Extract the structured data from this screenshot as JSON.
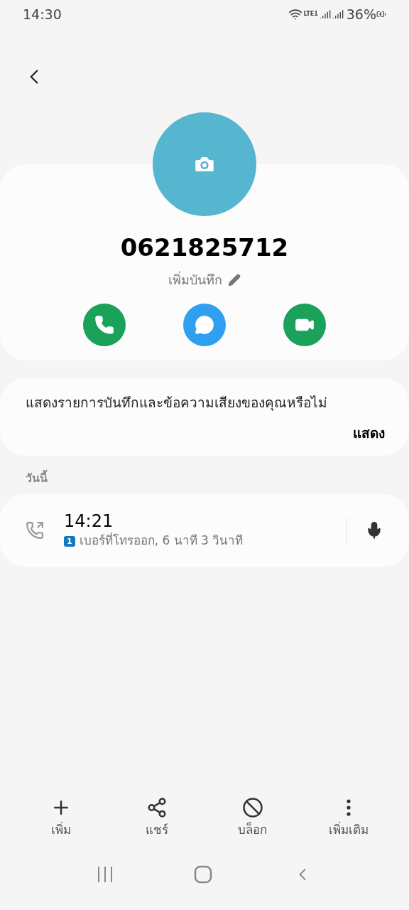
{
  "status_bar": {
    "time": "14:30",
    "network": "LTE1",
    "battery": "36%"
  },
  "contact": {
    "number": "0621825712",
    "note_label": "เพิ่มบันทึก"
  },
  "actions": [
    {
      "kind": "call"
    },
    {
      "kind": "message"
    },
    {
      "kind": "video"
    }
  ],
  "prompt": {
    "text": "แสดงรายการบันทึกและข้อความเสียงของคุณหรือไม่",
    "action": "แสดง"
  },
  "section": "วันนี้",
  "call_log": [
    {
      "kind": "outgoing",
      "time": "14:21",
      "sim": "1",
      "detail": "เบอร์ที่โทรออก, 6 นาที 3 วินาที"
    }
  ],
  "bottom_bar": [
    {
      "kind": "add",
      "label": "เพิ่ม"
    },
    {
      "kind": "share",
      "label": "แชร์"
    },
    {
      "kind": "block",
      "label": "บล็อก"
    },
    {
      "kind": "more",
      "label": "เพิ่มเติม"
    }
  ]
}
